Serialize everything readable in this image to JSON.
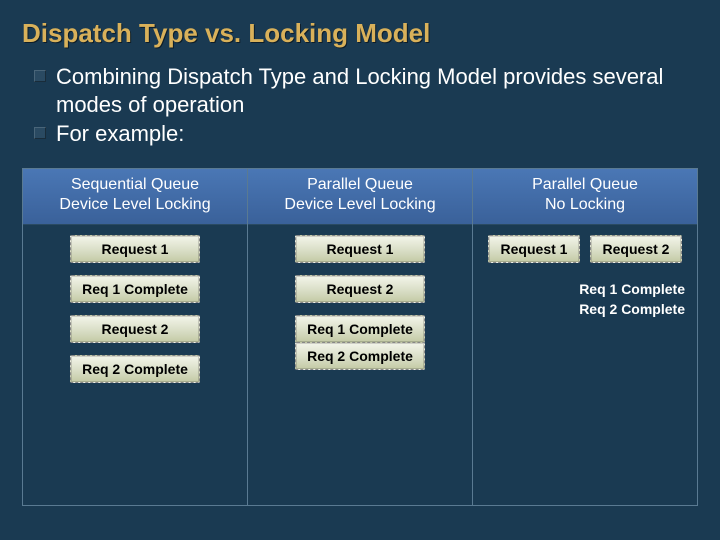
{
  "title": "Dispatch Type vs. Locking Model",
  "bullets": [
    "Combining Dispatch Type and Locking Model provides several modes of operation",
    "For example:"
  ],
  "columns": [
    {
      "header_line1": "Sequential Queue",
      "header_line2": "Device Level Locking",
      "items": [
        "Request 1",
        "Req 1 Complete",
        "Request 2",
        "Req 2 Complete"
      ]
    },
    {
      "header_line1": "Parallel Queue",
      "header_line2": "Device Level Locking",
      "items": [
        "Request 1",
        "Request 2"
      ],
      "tail": [
        "Req 1 Complete",
        "Req 2 Complete"
      ]
    },
    {
      "header_line1": "Parallel Queue",
      "header_line2": "No Locking",
      "row": [
        "Request 1",
        "Request 2"
      ],
      "completes": [
        "Req 1 Complete",
        "Req 2 Complete"
      ]
    }
  ]
}
